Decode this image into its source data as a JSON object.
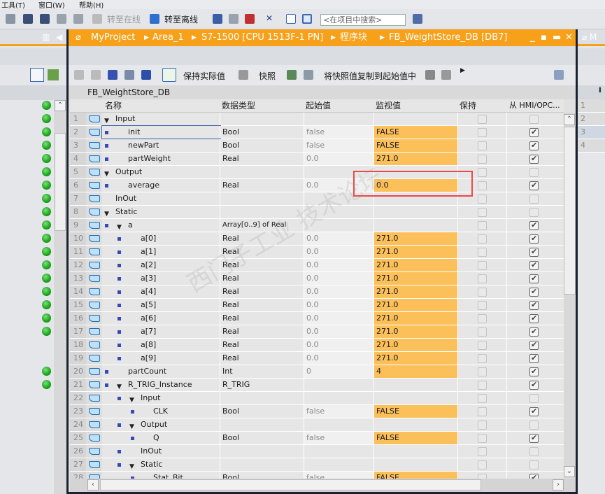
{
  "menu": [
    "工具(T)",
    "窗口(W)",
    "帮助(H)"
  ],
  "toolbar": {
    "go_online": "转至在线",
    "go_offline": "转至离线",
    "search_placeholder": "<在项目中搜索>"
  },
  "breadcrumb": [
    "MyProject",
    "Area_1",
    "S7-1500 [CPU 1513F-1 PN]",
    "程序块",
    "FB_WeightStore_DB [DB7]"
  ],
  "editor_toolbar": {
    "keep_actual": "保持实际值",
    "snapshot": "快照",
    "copy_snapshot": "将快照值复制到起始值中"
  },
  "db_name": "FB_WeightStore_DB",
  "columns": {
    "name": "名称",
    "type": "数据类型",
    "start": "起始值",
    "monitor": "监视值",
    "retain": "保持",
    "hmi": "从 HMI/OPC..."
  },
  "rows": [
    {
      "n": "1",
      "name": "Input",
      "d": 0,
      "exp": true,
      "type": "",
      "start": "",
      "mon": "",
      "hmi": false
    },
    {
      "n": "2",
      "name": "init",
      "d": 1,
      "type": "Bool",
      "start": "false",
      "mon": "FALSE",
      "hmi": true
    },
    {
      "n": "3",
      "name": "newPart",
      "d": 1,
      "type": "Bool",
      "start": "false",
      "mon": "FALSE",
      "hmi": true
    },
    {
      "n": "4",
      "name": "partWeight",
      "d": 1,
      "type": "Real",
      "start": "0.0",
      "mon": "271.0",
      "hmi": true
    },
    {
      "n": "5",
      "name": "Output",
      "d": 0,
      "exp": true,
      "type": "",
      "start": "",
      "mon": "",
      "hmi": false
    },
    {
      "n": "6",
      "name": "average",
      "d": 1,
      "type": "Real",
      "start": "0.0",
      "mon": "0.0",
      "hmi": true
    },
    {
      "n": "7",
      "name": "InOut",
      "d": 0,
      "type": "",
      "start": "",
      "mon": "",
      "hmi": false
    },
    {
      "n": "8",
      "name": "Static",
      "d": 0,
      "exp": true,
      "type": "",
      "start": "",
      "mon": "",
      "hmi": false
    },
    {
      "n": "9",
      "name": "a",
      "d": 1,
      "exp": true,
      "type": "Array[0..9] of Real",
      "start": "",
      "mon": "",
      "hmi": true
    },
    {
      "n": "10",
      "name": "a[0]",
      "d": 2,
      "type": "Real",
      "start": "0.0",
      "mon": "271.0",
      "hmi": true
    },
    {
      "n": "11",
      "name": "a[1]",
      "d": 2,
      "type": "Real",
      "start": "0.0",
      "mon": "271.0",
      "hmi": true
    },
    {
      "n": "12",
      "name": "a[2]",
      "d": 2,
      "type": "Real",
      "start": "0.0",
      "mon": "271.0",
      "hmi": true
    },
    {
      "n": "13",
      "name": "a[3]",
      "d": 2,
      "type": "Real",
      "start": "0.0",
      "mon": "271.0",
      "hmi": true
    },
    {
      "n": "14",
      "name": "a[4]",
      "d": 2,
      "type": "Real",
      "start": "0.0",
      "mon": "271.0",
      "hmi": true
    },
    {
      "n": "15",
      "name": "a[5]",
      "d": 2,
      "type": "Real",
      "start": "0.0",
      "mon": "271.0",
      "hmi": true
    },
    {
      "n": "16",
      "name": "a[6]",
      "d": 2,
      "type": "Real",
      "start": "0.0",
      "mon": "271.0",
      "hmi": true
    },
    {
      "n": "17",
      "name": "a[7]",
      "d": 2,
      "type": "Real",
      "start": "0.0",
      "mon": "271.0",
      "hmi": true
    },
    {
      "n": "18",
      "name": "a[8]",
      "d": 2,
      "type": "Real",
      "start": "0.0",
      "mon": "271.0",
      "hmi": true
    },
    {
      "n": "19",
      "name": "a[9]",
      "d": 2,
      "type": "Real",
      "start": "0.0",
      "mon": "271.0",
      "hmi": true
    },
    {
      "n": "20",
      "name": "partCount",
      "d": 1,
      "type": "Int",
      "start": "0",
      "mon": "4",
      "hmi": true
    },
    {
      "n": "21",
      "name": "R_TRIG_Instance",
      "d": 1,
      "exp": true,
      "type": "R_TRIG",
      "start": "",
      "mon": "",
      "hmi": true
    },
    {
      "n": "22",
      "name": "Input",
      "d": 2,
      "exp": true,
      "type": "",
      "start": "",
      "mon": "",
      "hmi": false
    },
    {
      "n": "23",
      "name": "CLK",
      "d": 3,
      "type": "Bool",
      "start": "false",
      "mon": "FALSE",
      "hmi": true
    },
    {
      "n": "24",
      "name": "Output",
      "d": 2,
      "exp": true,
      "type": "",
      "start": "",
      "mon": "",
      "hmi": false
    },
    {
      "n": "25",
      "name": "Q",
      "d": 3,
      "type": "Bool",
      "start": "false",
      "mon": "FALSE",
      "hmi": true
    },
    {
      "n": "26",
      "name": "InOut",
      "d": 2,
      "type": "",
      "start": "",
      "mon": "",
      "hmi": false
    },
    {
      "n": "27",
      "name": "Static",
      "d": 2,
      "exp": true,
      "type": "",
      "start": "",
      "mon": "",
      "hmi": false
    },
    {
      "n": "28",
      "name": "Stat_Bit",
      "d": 3,
      "type": "Bool",
      "start": "false",
      "mon": "FALSE",
      "hmi": true
    }
  ],
  "right_panel_rows": [
    "1",
    "2",
    "3",
    "4"
  ],
  "colors": {
    "accent": "#f7a11a",
    "monitor": "#fcc05a",
    "highlight": "#e84a4a"
  }
}
